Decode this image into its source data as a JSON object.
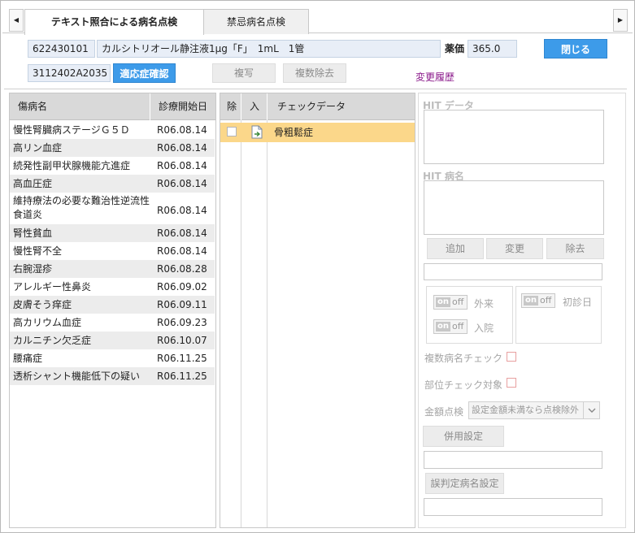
{
  "tabs": {
    "left_arrow": "◀",
    "right_arrow": "▶",
    "items": [
      "テキスト照合による病名点検",
      "禁忌病名点検"
    ]
  },
  "header": {
    "drug_code": "622430101",
    "drug_name": "カルシトリオール静注液1μg「F」　1mL　1管",
    "price_label": "薬価",
    "price_value": "365.0",
    "close_label": "閉じる",
    "yj_code": "3112402A2035",
    "indication_label": "適応症確認",
    "copy_label": "複写",
    "multi_remove_label": "複数除去",
    "history_label": "変更履歴"
  },
  "diseases": {
    "columns": [
      "傷病名",
      "診療開始日"
    ],
    "rows": [
      [
        "慢性腎臓病ステージＧ５Ｄ",
        "R06.08.14"
      ],
      [
        "高リン血症",
        "R06.08.14"
      ],
      [
        "続発性副甲状腺機能亢進症",
        "R06.08.14"
      ],
      [
        "高血圧症",
        "R06.08.14"
      ],
      [
        "維持療法の必要な難治性逆流性食道炎",
        "R06.08.14"
      ],
      [
        "腎性貧血",
        "R06.08.14"
      ],
      [
        "慢性腎不全",
        "R06.08.14"
      ],
      [
        "右腕湿疹",
        "R06.08.28"
      ],
      [
        "アレルギー性鼻炎",
        "R06.09.02"
      ],
      [
        "皮膚そう痒症",
        "R06.09.11"
      ],
      [
        "高カリウム血症",
        "R06.09.23"
      ],
      [
        "カルニチン欠乏症",
        "R06.10.07"
      ],
      [
        "腰痛症",
        "R06.11.25"
      ],
      [
        "透析シャント機能低下の疑い",
        "R06.11.25"
      ]
    ]
  },
  "checkdata": {
    "columns": [
      "除",
      "入",
      "チェックデータ"
    ],
    "rows": [
      {
        "name": "骨粗鬆症",
        "icon": "document-arrow-icon"
      }
    ]
  },
  "side": {
    "hit_data_label": "HIT データ",
    "hit_disease_label": "HIT 病名",
    "add_label": "追加",
    "change_label": "変更",
    "remove_label": "除去",
    "toggle_on": "on",
    "toggle_off": "off",
    "outpatient_label": "外来",
    "inpatient_label": "入院",
    "first_visit_label": "初診日",
    "multi_check_label": "複数病名チェック",
    "site_check_label": "部位チェック対象",
    "amount_check_label": "金額点検",
    "amount_select_value": "設定金額未満なら点検除外",
    "combined_label": "併用設定",
    "misjudge_label": "誤判定病名設定"
  },
  "colors": {
    "accent": "#3d9be9",
    "selected_row": "#fbd78a",
    "field_bg": "#e8eef7",
    "link": "#8b1a8b"
  }
}
